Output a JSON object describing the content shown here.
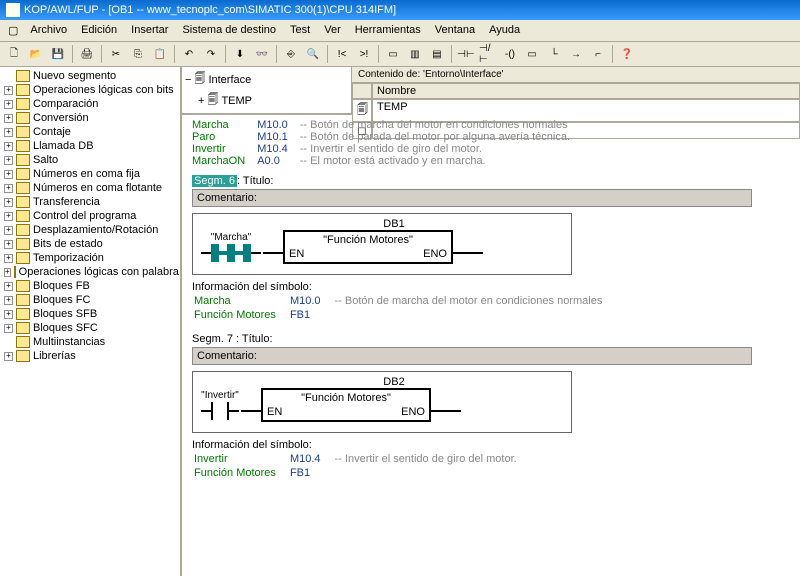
{
  "title": "KOP/AWL/FUP  - [OB1 -- www_tecnoplc_com\\SIMATIC 300(1)\\CPU 314IFM]",
  "menu": [
    "Archivo",
    "Edición",
    "Insertar",
    "Sistema de destino",
    "Test",
    "Ver",
    "Herramientas",
    "Ventana",
    "Ayuda"
  ],
  "sidebar": {
    "items": [
      {
        "exp": "",
        "label": "Nuevo segmento"
      },
      {
        "exp": "+",
        "label": "Operaciones lógicas con bits"
      },
      {
        "exp": "+",
        "label": "Comparación"
      },
      {
        "exp": "+",
        "label": "Conversión"
      },
      {
        "exp": "+",
        "label": "Contaje"
      },
      {
        "exp": "+",
        "label": "Llamada DB"
      },
      {
        "exp": "+",
        "label": "Salto"
      },
      {
        "exp": "+",
        "label": "Números en coma fija"
      },
      {
        "exp": "+",
        "label": "Números en coma flotante"
      },
      {
        "exp": "+",
        "label": "Transferencia"
      },
      {
        "exp": "+",
        "label": "Control del programa"
      },
      {
        "exp": "+",
        "label": "Desplazamiento/Rotación"
      },
      {
        "exp": "+",
        "label": "Bits de estado"
      },
      {
        "exp": "+",
        "label": "Temporización"
      },
      {
        "exp": "+",
        "label": "Operaciones lógicas con palabra"
      },
      {
        "exp": "+",
        "label": "Bloques FB"
      },
      {
        "exp": "+",
        "label": "Bloques FC"
      },
      {
        "exp": "+",
        "label": "Bloques SFB"
      },
      {
        "exp": "+",
        "label": "Bloques SFC"
      },
      {
        "exp": "",
        "label": "Multiinstancias"
      },
      {
        "exp": "+",
        "label": "Librerías"
      }
    ]
  },
  "interface": {
    "left_root": "Interface",
    "left_child": "TEMP",
    "hdr": "Contenido de: 'Entorno\\Interface'",
    "col": "Nombre",
    "row1": "TEMP"
  },
  "vars": [
    {
      "name": "Marcha",
      "addr": "M10.0",
      "comment": "-- Botón de marcha del motor en condiciones normales"
    },
    {
      "name": "Paro",
      "addr": "M10.1",
      "comment": "-- Botón de parada del motor por alguna avería técnica."
    },
    {
      "name": "Invertir",
      "addr": "M10.4",
      "comment": "-- Invertir el sentido de giro del motor."
    },
    {
      "name": "MarchaON",
      "addr": "A0.0",
      "comment": "-- El motor está activado y en marcha."
    }
  ],
  "segm6": {
    "title_lbl": "Segm. 6",
    "title_suffix": ": Título:",
    "comment": "Comentario:",
    "db": "DB1",
    "contact": "\"Marcha\"",
    "fb": "\"Función Motores\"",
    "en": "EN",
    "eno": "ENO",
    "info_hdr": "Información del símbolo:",
    "info": [
      {
        "name": "Marcha",
        "addr": "M10.0",
        "comment": "-- Botón de marcha del motor en condiciones normales"
      },
      {
        "name": "Función Motores",
        "addr": "FB1",
        "comment": ""
      }
    ]
  },
  "segm7": {
    "title": "Segm. 7 : Título:",
    "comment": "Comentario:",
    "db": "DB2",
    "contact": "\"Invertir\"",
    "fb": "\"Función Motores\"",
    "en": "EN",
    "eno": "ENO",
    "info_hdr": "Información del símbolo:",
    "info": [
      {
        "name": "Invertir",
        "addr": "M10.4",
        "comment": "-- Invertir el sentido de giro del motor."
      },
      {
        "name": "Función Motores",
        "addr": "FB1",
        "comment": ""
      }
    ]
  }
}
